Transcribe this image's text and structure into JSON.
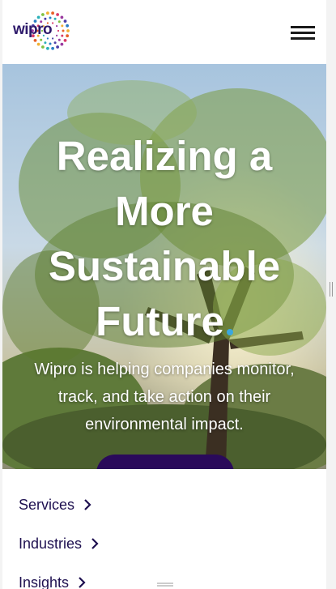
{
  "header": {
    "logo_text": "wipro",
    "logo_icon": "wipro-dotted-sun-logo",
    "menu_icon": "hamburger-menu-icon"
  },
  "hero": {
    "title_lines": [
      "Realizing a",
      "More",
      "Sustainable",
      "Future"
    ],
    "title_dot_color": "#3aa7e0",
    "subtitle": "Wipro is helping companies monitor, track, and take action on their environmental impact.",
    "cta_color": "#2a0a5a"
  },
  "nav": {
    "items": [
      {
        "label": "Services",
        "icon": "chevron-right-icon"
      },
      {
        "label": "Industries",
        "icon": "chevron-right-icon"
      },
      {
        "label": "Insights",
        "icon": "chevron-right-icon"
      }
    ]
  },
  "colors": {
    "nav_text": "#1e1050",
    "brand_purple": "#2e1a6b"
  }
}
